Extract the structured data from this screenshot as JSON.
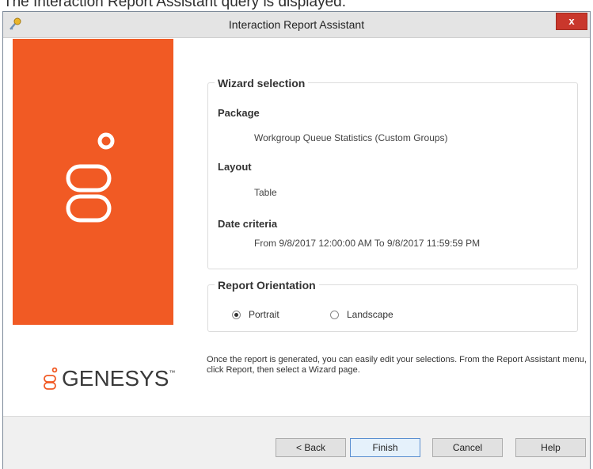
{
  "caption": "The Interaction Report Assistant query is displayed.",
  "window": {
    "title": "Interaction Report Assistant",
    "close_glyph": "x",
    "app_icon": "key-icon"
  },
  "branding": {
    "logo_text": "GENESYS",
    "trademark": "™",
    "panel_color": "#f15a24"
  },
  "wizard_selection": {
    "title": "Wizard selection",
    "package_label": "Package",
    "package_value": "Workgroup Queue Statistics (Custom Groups)",
    "layout_label": "Layout",
    "layout_value": "Table",
    "date_label": "Date criteria",
    "date_value": "From 9/8/2017 12:00:00 AM To 9/8/2017 11:59:59 PM"
  },
  "report_orientation": {
    "title": "Report Orientation",
    "options": [
      {
        "label": "Portrait",
        "selected": true
      },
      {
        "label": "Landscape",
        "selected": false
      }
    ]
  },
  "info_text": "Once the report is generated, you can easily edit your selections. From the Report Assistant menu, click Report, then select a Wizard page.",
  "buttons": {
    "back": "< Back",
    "finish": "Finish",
    "cancel": "Cancel",
    "help": "Help"
  }
}
